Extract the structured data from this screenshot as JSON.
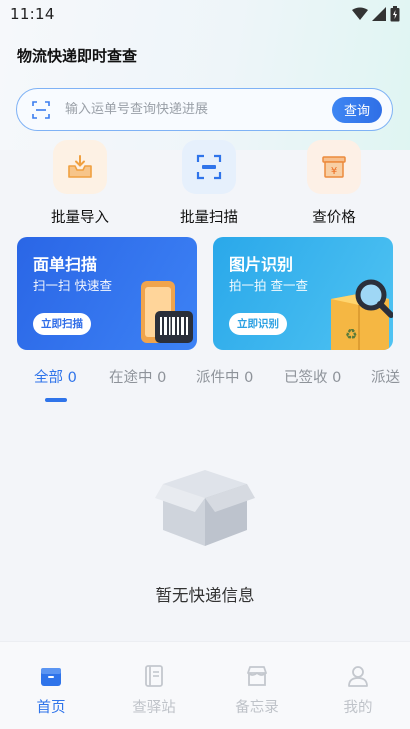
{
  "status_bar": {
    "time": "11:14"
  },
  "header": {
    "title": "物流快递即时查查"
  },
  "search": {
    "placeholder": "输入运单号查询快递进展",
    "button_label": "查询"
  },
  "quick_actions": [
    {
      "label": "批量导入",
      "icon": "inbox-download-icon"
    },
    {
      "label": "批量扫描",
      "icon": "scan-frame-icon"
    },
    {
      "label": "查价格",
      "icon": "price-box-icon"
    }
  ],
  "cards": [
    {
      "title": "面单扫描",
      "subtitle": "扫一扫 快速查",
      "button_label": "立即扫描",
      "color": "#2f6de8"
    },
    {
      "title": "图片识别",
      "subtitle": "拍一拍 查一查",
      "button_label": "立即识别",
      "color": "#2fb0ea"
    }
  ],
  "tabs": [
    {
      "label": "全部 0",
      "active": true
    },
    {
      "label": "在途中 0",
      "active": false
    },
    {
      "label": "派件中 0",
      "active": false
    },
    {
      "label": "已签收 0",
      "active": false
    },
    {
      "label": "派送",
      "active": false
    }
  ],
  "empty_state": {
    "text": "暂无快递信息"
  },
  "bottom_nav": [
    {
      "label": "首页",
      "icon": "home-box-icon",
      "active": true
    },
    {
      "label": "查驿站",
      "icon": "notebook-icon",
      "active": false
    },
    {
      "label": "备忘录",
      "icon": "store-icon",
      "active": false
    },
    {
      "label": "我的",
      "icon": "person-icon",
      "active": false
    }
  ],
  "colors": {
    "accent": "#2f74ea",
    "inactive": "#bfc3c9"
  }
}
